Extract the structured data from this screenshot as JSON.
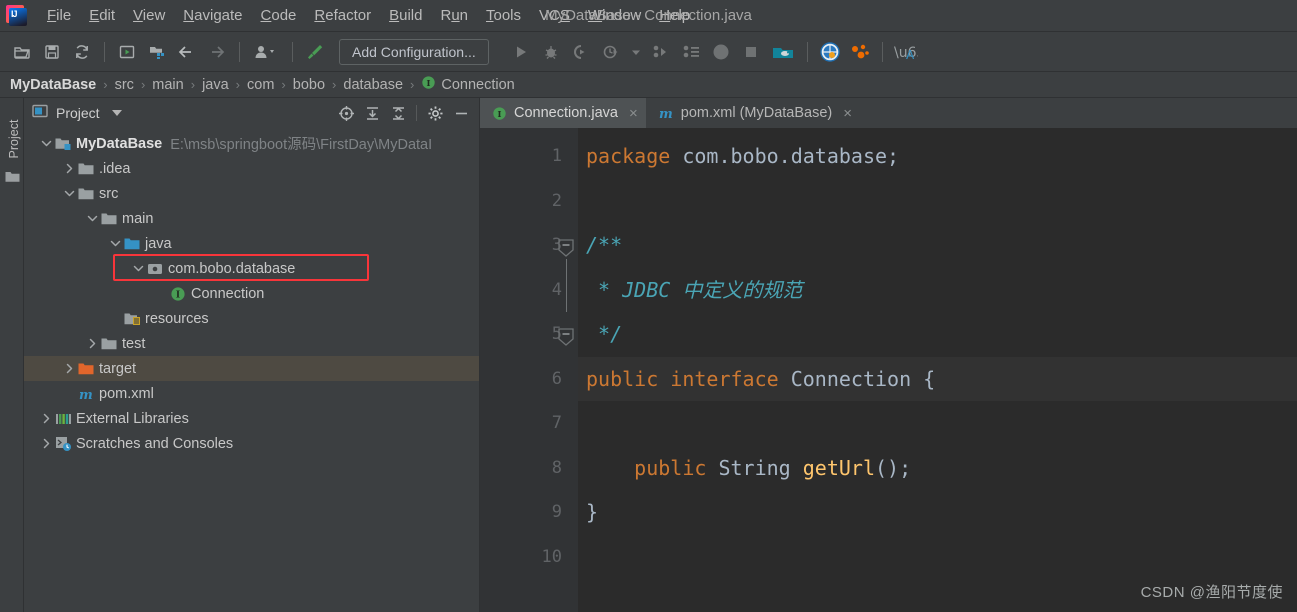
{
  "window": {
    "title": "MyDataBase - Connection.java",
    "logo_text": "IJ"
  },
  "menubar": {
    "items": [
      {
        "name": "file",
        "pre": "",
        "mn": "F",
        "post": "ile"
      },
      {
        "name": "edit",
        "pre": "",
        "mn": "E",
        "post": "dit"
      },
      {
        "name": "view",
        "pre": "",
        "mn": "V",
        "post": "iew"
      },
      {
        "name": "navigate",
        "pre": "",
        "mn": "N",
        "post": "avigate"
      },
      {
        "name": "code",
        "pre": "",
        "mn": "C",
        "post": "ode"
      },
      {
        "name": "refactor",
        "pre": "",
        "mn": "R",
        "post": "efactor"
      },
      {
        "name": "build",
        "pre": "",
        "mn": "B",
        "post": "uild"
      },
      {
        "name": "run",
        "pre": "R",
        "mn": "u",
        "post": "n"
      },
      {
        "name": "tools",
        "pre": "",
        "mn": "T",
        "post": "ools"
      },
      {
        "name": "vcs",
        "pre": "VC",
        "mn": "S",
        "post": ""
      },
      {
        "name": "window",
        "pre": "",
        "mn": "W",
        "post": "indow"
      },
      {
        "name": "help",
        "pre": "",
        "mn": "H",
        "post": "elp"
      }
    ]
  },
  "toolbar": {
    "icons": [
      "open-folder-icon",
      "save-icon",
      "sync-icon",
      "run-config-icon",
      "project-structure-icon",
      "back-arrow-icon",
      "forward-arrow-icon",
      "vcs-user-icon",
      "build-hammer-icon"
    ],
    "add_configuration_label": "Add Configuration...",
    "right_icons": [
      "run-icon",
      "debug-icon",
      "run-coverage-icon",
      "profiler-icon",
      "run-dropdown-icon",
      "run-tests-icon",
      "run-with-profiler-icon",
      "stop-circle-icon",
      "stop-square-icon",
      "tomcat-icon",
      "browser-icon",
      "tool-dots-icon",
      "translate-icon"
    ]
  },
  "breadcrumb": {
    "items": [
      {
        "label": "MyDataBase",
        "root": true,
        "icon": ""
      },
      {
        "label": "src",
        "root": false,
        "icon": ""
      },
      {
        "label": "main",
        "root": false,
        "icon": ""
      },
      {
        "label": "java",
        "root": false,
        "icon": ""
      },
      {
        "label": "com",
        "root": false,
        "icon": ""
      },
      {
        "label": "bobo",
        "root": false,
        "icon": ""
      },
      {
        "label": "database",
        "root": false,
        "icon": ""
      },
      {
        "label": "Connection",
        "root": false,
        "icon": "interface-icon"
      }
    ],
    "separator": "›"
  },
  "left_strip": {
    "tab_label": "Project",
    "icon": "folder-icon"
  },
  "project_panel": {
    "title": "Project",
    "header_icons": [
      "locate-target-icon",
      "expand-all-icon",
      "collapse-all-icon",
      "settings-gear-icon",
      "hide-minimize-icon"
    ],
    "tree": [
      {
        "name": "MyDataBase",
        "depth": 0,
        "arrow": "down",
        "icon": "module-folder-icon",
        "bold": true,
        "path": "E:\\msb\\springboot源码\\FirstDay\\MyDataI",
        "selected": false,
        "highlight": false
      },
      {
        "name": ".idea",
        "depth": 1,
        "arrow": "right",
        "icon": "folder-icon",
        "bold": false,
        "path": "",
        "selected": false,
        "highlight": false
      },
      {
        "name": "src",
        "depth": 1,
        "arrow": "down",
        "icon": "folder-icon",
        "bold": false,
        "path": "",
        "selected": false,
        "highlight": false
      },
      {
        "name": "main",
        "depth": 2,
        "arrow": "down",
        "icon": "folder-icon",
        "bold": false,
        "path": "",
        "selected": false,
        "highlight": false
      },
      {
        "name": "java",
        "depth": 3,
        "arrow": "down",
        "icon": "source-root-icon",
        "bold": false,
        "path": "",
        "selected": false,
        "highlight": false
      },
      {
        "name": "com.bobo.database",
        "depth": 4,
        "arrow": "down",
        "icon": "package-icon",
        "bold": false,
        "path": "",
        "selected": false,
        "highlight": true
      },
      {
        "name": "Connection",
        "depth": 5,
        "arrow": "none",
        "icon": "interface-icon",
        "bold": false,
        "path": "",
        "selected": false,
        "highlight": false
      },
      {
        "name": "resources",
        "depth": 3,
        "arrow": "none",
        "icon": "resources-icon",
        "bold": false,
        "path": "",
        "selected": false,
        "highlight": false
      },
      {
        "name": "test",
        "depth": 2,
        "arrow": "right",
        "icon": "folder-icon",
        "bold": false,
        "path": "",
        "selected": false,
        "highlight": false
      },
      {
        "name": "target",
        "depth": 1,
        "arrow": "right",
        "icon": "excluded-folder-icon",
        "bold": false,
        "path": "",
        "selected": true,
        "highlight": false
      },
      {
        "name": "pom.xml",
        "depth": 1,
        "arrow": "none",
        "icon": "maven-icon",
        "bold": false,
        "path": "",
        "selected": false,
        "highlight": false
      },
      {
        "name": "External Libraries",
        "depth": 0,
        "arrow": "right",
        "icon": "libraries-icon",
        "bold": false,
        "path": "",
        "selected": false,
        "highlight": false
      },
      {
        "name": "Scratches and Consoles",
        "depth": 0,
        "arrow": "right",
        "icon": "scratches-icon",
        "bold": false,
        "path": "",
        "selected": false,
        "highlight": false
      }
    ]
  },
  "editor": {
    "tabs": [
      {
        "label": "Connection.java",
        "icon": "interface-icon",
        "active": true,
        "close": "×"
      },
      {
        "label": "pom.xml (MyDataBase)",
        "icon": "maven-icon",
        "active": false,
        "close": "×"
      }
    ],
    "line_numbers": [
      "1",
      "2",
      "3",
      "4",
      "5",
      "6",
      "7",
      "8",
      "9",
      "10"
    ],
    "lines": [
      {
        "n": 1,
        "caret": false,
        "fold": "none",
        "tokens": [
          {
            "t": "package",
            "c": "kw"
          },
          {
            "t": " com.bobo.database;",
            "c": "pkg"
          }
        ]
      },
      {
        "n": 2,
        "caret": false,
        "fold": "none",
        "tokens": []
      },
      {
        "n": 3,
        "caret": false,
        "fold": "start",
        "tokens": [
          {
            "t": "/**",
            "c": "doc-i"
          }
        ]
      },
      {
        "n": 4,
        "caret": false,
        "fold": "mid",
        "tokens": [
          {
            "t": " * ",
            "c": "doc-i"
          },
          {
            "t": "JDBC 中定义的规范",
            "c": "doc-i"
          }
        ]
      },
      {
        "n": 5,
        "caret": false,
        "fold": "end",
        "tokens": [
          {
            "t": " */",
            "c": "doc-i"
          }
        ]
      },
      {
        "n": 6,
        "caret": true,
        "fold": "none",
        "tokens": [
          {
            "t": "public interface ",
            "c": "kw"
          },
          {
            "t": "Connection",
            "c": "type"
          },
          {
            "t": " {",
            "c": "pl"
          }
        ]
      },
      {
        "n": 7,
        "caret": false,
        "fold": "none",
        "tokens": []
      },
      {
        "n": 8,
        "caret": false,
        "fold": "none",
        "tokens": [
          {
            "t": "    public ",
            "c": "kw"
          },
          {
            "t": "String ",
            "c": "type"
          },
          {
            "t": "getUrl",
            "c": "mth"
          },
          {
            "t": "();",
            "c": "pl"
          }
        ]
      },
      {
        "n": 9,
        "caret": false,
        "fold": "none",
        "tokens": [
          {
            "t": "}",
            "c": "pl"
          }
        ]
      },
      {
        "n": 10,
        "caret": false,
        "fold": "none",
        "tokens": []
      }
    ]
  },
  "watermark": "CSDN @渔阳节度使",
  "colors": {
    "panel_bg": "#3c3f41",
    "editor_bg": "#2b2b2b",
    "gutter_bg": "#313335",
    "selection_inactive": "#4e4a42",
    "highlight_box": "#f8353a",
    "keyword": "#cc7832",
    "javadoc": "#4aa5b5",
    "method": "#ffc66d",
    "type": "#a9b7c6",
    "accent_green": "#499c54"
  }
}
